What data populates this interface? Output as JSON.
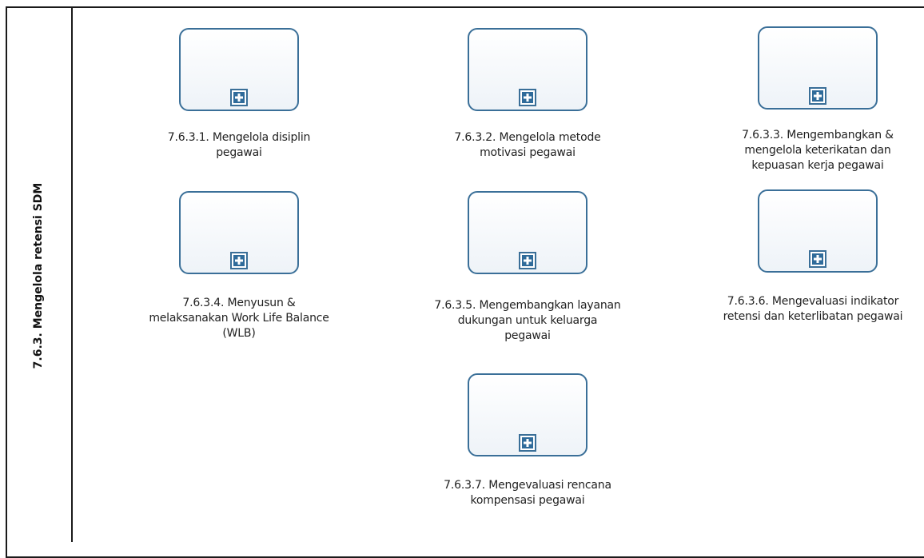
{
  "lane": {
    "label": "7.6.3. Mengelola retensi SDM"
  },
  "tasks": [
    {
      "lines": [
        "7.6.3.1. Mengelola disiplin",
        "pegawai"
      ]
    },
    {
      "lines": [
        "7.6.3.2. Mengelola metode",
        "motivasi pegawai"
      ]
    },
    {
      "lines": [
        "7.6.3.3. Mengembangkan &",
        "mengelola keterikatan dan",
        "kepuasan kerja pegawai"
      ]
    },
    {
      "lines": [
        "7.6.3.4. Menyusun &",
        "melaksanakan Work Life Balance",
        "(WLB)"
      ]
    },
    {
      "lines": [
        "7.6.3.5. Mengembangkan layanan",
        "dukungan untuk keluarga",
        "pegawai"
      ]
    },
    {
      "lines": [
        "7.6.3.6. Mengevaluasi indikator",
        "retensi dan keterlibatan pegawai"
      ]
    },
    {
      "lines": [
        "7.6.3.7. Mengevaluasi rencana",
        "kompensasi pegawai"
      ]
    }
  ],
  "colors": {
    "task_border": "#3a6f98",
    "marker_fill": "#2f6b9a",
    "frame": "#1a1a1a"
  },
  "icons": {
    "expand_marker": "plus-square-icon"
  }
}
